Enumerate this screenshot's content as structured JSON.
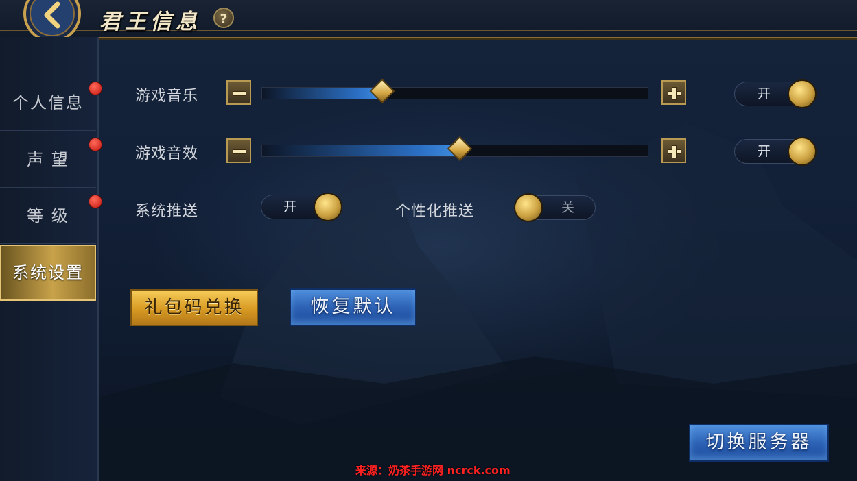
{
  "header": {
    "title": "君王信息",
    "help_label": "?"
  },
  "sidebar": {
    "items": [
      {
        "label": "个人信息",
        "badge": true,
        "active": false
      },
      {
        "label": "声 望",
        "badge": true,
        "active": false
      },
      {
        "label": "等 级",
        "badge": true,
        "active": false
      },
      {
        "label": "系统设置",
        "badge": false,
        "active": true
      }
    ]
  },
  "settings": {
    "music": {
      "label": "游戏音乐",
      "volume": 0.31,
      "toggle": "开"
    },
    "sfx": {
      "label": "游戏音效",
      "volume": 0.51,
      "toggle": "开"
    },
    "system_push": {
      "label": "系统推送",
      "toggle": "开"
    },
    "personal_push": {
      "label": "个性化推送",
      "toggle": "关"
    }
  },
  "buttons": {
    "gift_code": "礼包码兑换",
    "restore_default": "恢复默认",
    "switch_server": "切换服务器"
  },
  "watermark": "来源：奶茶手游网 ncrck.com",
  "colors": {
    "accent_gold": "#c8a24a",
    "badge_red": "#e0221a",
    "slider_blue": "#2b6fc4"
  }
}
